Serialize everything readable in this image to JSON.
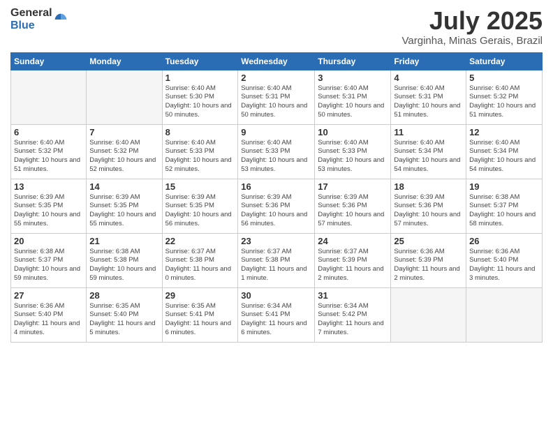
{
  "logo": {
    "general": "General",
    "blue": "Blue"
  },
  "header": {
    "month": "July 2025",
    "location": "Varginha, Minas Gerais, Brazil"
  },
  "weekdays": [
    "Sunday",
    "Monday",
    "Tuesday",
    "Wednesday",
    "Thursday",
    "Friday",
    "Saturday"
  ],
  "weeks": [
    [
      {
        "day": "",
        "detail": ""
      },
      {
        "day": "",
        "detail": ""
      },
      {
        "day": "1",
        "detail": "Sunrise: 6:40 AM\nSunset: 5:30 PM\nDaylight: 10 hours\nand 50 minutes."
      },
      {
        "day": "2",
        "detail": "Sunrise: 6:40 AM\nSunset: 5:31 PM\nDaylight: 10 hours\nand 50 minutes."
      },
      {
        "day": "3",
        "detail": "Sunrise: 6:40 AM\nSunset: 5:31 PM\nDaylight: 10 hours\nand 50 minutes."
      },
      {
        "day": "4",
        "detail": "Sunrise: 6:40 AM\nSunset: 5:31 PM\nDaylight: 10 hours\nand 51 minutes."
      },
      {
        "day": "5",
        "detail": "Sunrise: 6:40 AM\nSunset: 5:32 PM\nDaylight: 10 hours\nand 51 minutes."
      }
    ],
    [
      {
        "day": "6",
        "detail": "Sunrise: 6:40 AM\nSunset: 5:32 PM\nDaylight: 10 hours\nand 51 minutes."
      },
      {
        "day": "7",
        "detail": "Sunrise: 6:40 AM\nSunset: 5:32 PM\nDaylight: 10 hours\nand 52 minutes."
      },
      {
        "day": "8",
        "detail": "Sunrise: 6:40 AM\nSunset: 5:33 PM\nDaylight: 10 hours\nand 52 minutes."
      },
      {
        "day": "9",
        "detail": "Sunrise: 6:40 AM\nSunset: 5:33 PM\nDaylight: 10 hours\nand 53 minutes."
      },
      {
        "day": "10",
        "detail": "Sunrise: 6:40 AM\nSunset: 5:33 PM\nDaylight: 10 hours\nand 53 minutes."
      },
      {
        "day": "11",
        "detail": "Sunrise: 6:40 AM\nSunset: 5:34 PM\nDaylight: 10 hours\nand 54 minutes."
      },
      {
        "day": "12",
        "detail": "Sunrise: 6:40 AM\nSunset: 5:34 PM\nDaylight: 10 hours\nand 54 minutes."
      }
    ],
    [
      {
        "day": "13",
        "detail": "Sunrise: 6:39 AM\nSunset: 5:35 PM\nDaylight: 10 hours\nand 55 minutes."
      },
      {
        "day": "14",
        "detail": "Sunrise: 6:39 AM\nSunset: 5:35 PM\nDaylight: 10 hours\nand 55 minutes."
      },
      {
        "day": "15",
        "detail": "Sunrise: 6:39 AM\nSunset: 5:35 PM\nDaylight: 10 hours\nand 56 minutes."
      },
      {
        "day": "16",
        "detail": "Sunrise: 6:39 AM\nSunset: 5:36 PM\nDaylight: 10 hours\nand 56 minutes."
      },
      {
        "day": "17",
        "detail": "Sunrise: 6:39 AM\nSunset: 5:36 PM\nDaylight: 10 hours\nand 57 minutes."
      },
      {
        "day": "18",
        "detail": "Sunrise: 6:39 AM\nSunset: 5:36 PM\nDaylight: 10 hours\nand 57 minutes."
      },
      {
        "day": "19",
        "detail": "Sunrise: 6:38 AM\nSunset: 5:37 PM\nDaylight: 10 hours\nand 58 minutes."
      }
    ],
    [
      {
        "day": "20",
        "detail": "Sunrise: 6:38 AM\nSunset: 5:37 PM\nDaylight: 10 hours\nand 59 minutes."
      },
      {
        "day": "21",
        "detail": "Sunrise: 6:38 AM\nSunset: 5:38 PM\nDaylight: 10 hours\nand 59 minutes."
      },
      {
        "day": "22",
        "detail": "Sunrise: 6:37 AM\nSunset: 5:38 PM\nDaylight: 11 hours\nand 0 minutes."
      },
      {
        "day": "23",
        "detail": "Sunrise: 6:37 AM\nSunset: 5:38 PM\nDaylight: 11 hours\nand 1 minute."
      },
      {
        "day": "24",
        "detail": "Sunrise: 6:37 AM\nSunset: 5:39 PM\nDaylight: 11 hours\nand 2 minutes."
      },
      {
        "day": "25",
        "detail": "Sunrise: 6:36 AM\nSunset: 5:39 PM\nDaylight: 11 hours\nand 2 minutes."
      },
      {
        "day": "26",
        "detail": "Sunrise: 6:36 AM\nSunset: 5:40 PM\nDaylight: 11 hours\nand 3 minutes."
      }
    ],
    [
      {
        "day": "27",
        "detail": "Sunrise: 6:36 AM\nSunset: 5:40 PM\nDaylight: 11 hours\nand 4 minutes."
      },
      {
        "day": "28",
        "detail": "Sunrise: 6:35 AM\nSunset: 5:40 PM\nDaylight: 11 hours\nand 5 minutes."
      },
      {
        "day": "29",
        "detail": "Sunrise: 6:35 AM\nSunset: 5:41 PM\nDaylight: 11 hours\nand 6 minutes."
      },
      {
        "day": "30",
        "detail": "Sunrise: 6:34 AM\nSunset: 5:41 PM\nDaylight: 11 hours\nand 6 minutes."
      },
      {
        "day": "31",
        "detail": "Sunrise: 6:34 AM\nSunset: 5:42 PM\nDaylight: 11 hours\nand 7 minutes."
      },
      {
        "day": "",
        "detail": ""
      },
      {
        "day": "",
        "detail": ""
      }
    ]
  ]
}
